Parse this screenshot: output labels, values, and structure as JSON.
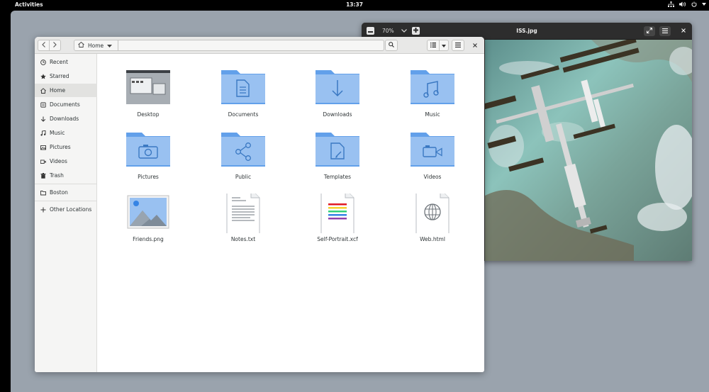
{
  "topbar": {
    "activities": "Activities",
    "clock": "13:37",
    "icons": [
      "network-icon",
      "volume-icon",
      "power-icon",
      "menu-arrow-icon"
    ]
  },
  "viewer": {
    "title": "ISS.jpg",
    "zoom": "70%",
    "icons": [
      "zoom-out-icon",
      "zoom-dropdown-icon",
      "zoom-in-icon",
      "fullscreen-icon",
      "menu-icon",
      "close-icon"
    ]
  },
  "files": {
    "path": "Home",
    "icons": [
      "back-icon",
      "forward-icon",
      "home-icon",
      "path-dropdown-icon",
      "search-icon",
      "list-view-icon",
      "view-dropdown-icon",
      "menu-icon",
      "close-icon"
    ],
    "sidebar": [
      {
        "label": "Recent",
        "icon": "clock-icon"
      },
      {
        "label": "Starred",
        "icon": "star-icon"
      },
      {
        "label": "Home",
        "icon": "home-icon",
        "active": true
      },
      {
        "label": "Documents",
        "icon": "document-icon"
      },
      {
        "label": "Downloads",
        "icon": "download-icon"
      },
      {
        "label": "Music",
        "icon": "music-icon"
      },
      {
        "label": "Pictures",
        "icon": "picture-icon"
      },
      {
        "label": "Videos",
        "icon": "video-icon"
      },
      {
        "label": "Trash",
        "icon": "trash-icon"
      },
      {
        "label": "Boston",
        "icon": "folder-icon"
      },
      {
        "label": "Other Locations",
        "icon": "plus-icon"
      }
    ],
    "items": [
      {
        "name": "Desktop",
        "kind": "desktop-folder"
      },
      {
        "name": "Documents",
        "kind": "folder-documents"
      },
      {
        "name": "Downloads",
        "kind": "folder-downloads"
      },
      {
        "name": "Music",
        "kind": "folder-music"
      },
      {
        "name": "Pictures",
        "kind": "folder-pictures"
      },
      {
        "name": "Public",
        "kind": "folder-public"
      },
      {
        "name": "Templates",
        "kind": "folder-templates"
      },
      {
        "name": "Videos",
        "kind": "folder-videos"
      },
      {
        "name": "Friends.png",
        "kind": "image-file"
      },
      {
        "name": "Notes.txt",
        "kind": "text-file"
      },
      {
        "name": "Self-Portrait.xcf",
        "kind": "xcf-file"
      },
      {
        "name": "Web.html",
        "kind": "html-file"
      }
    ]
  },
  "colors": {
    "folder": "#62a0ea",
    "folder_light": "#99c1f1",
    "desktop_bg": "#9aa3ad"
  }
}
